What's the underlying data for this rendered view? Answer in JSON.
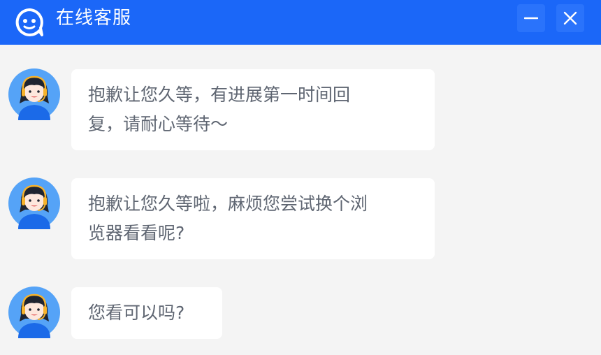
{
  "header": {
    "title": "在线客服",
    "brand_color": "#1b67f8",
    "logo_icon": "chat-smile-icon",
    "minimize_icon": "minimize-icon",
    "close_icon": "close-icon"
  },
  "messages": [
    {
      "sender": "agent",
      "avatar_icon": "agent-avatar-icon",
      "lines": [
        "抱歉让您久等，有进展第一时间回",
        "复，请耐心等待～"
      ]
    },
    {
      "sender": "agent",
      "avatar_icon": "agent-avatar-icon",
      "lines": [
        "抱歉让您久等啦，麻烦您尝试换个浏",
        "览器看看呢?"
      ]
    },
    {
      "sender": "agent",
      "avatar_icon": "agent-avatar-icon",
      "lines": [
        "您看可以吗?"
      ]
    }
  ]
}
